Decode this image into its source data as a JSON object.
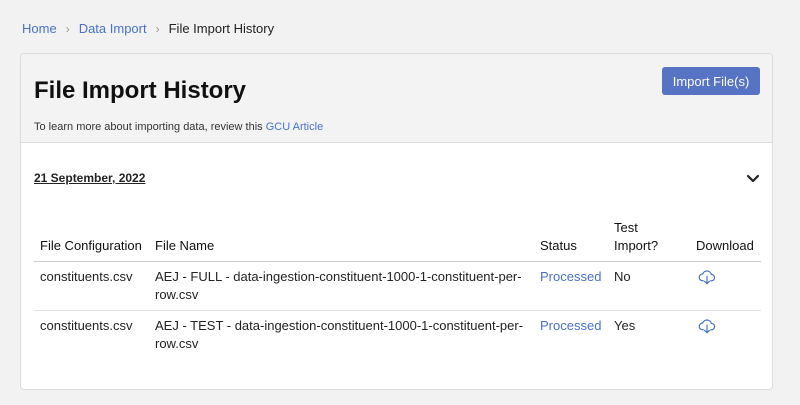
{
  "breadcrumb": {
    "items": [
      "Home",
      "Data Import"
    ],
    "current": "File Import History"
  },
  "header": {
    "title": "File Import History",
    "learn_more_prefix": "To learn more about importing data, review this",
    "learn_more_link": "GCU Article",
    "import_button": "Import File(s)"
  },
  "section": {
    "date": "21 September, 2022"
  },
  "table": {
    "headers": {
      "config": "File Configuration",
      "name": "File Name",
      "status": "Status",
      "test": "Test Import?",
      "download": "Download"
    },
    "rows": [
      {
        "config": "constituents.csv",
        "name": "AEJ - FULL - data-ingestion-constituent-1000-1-constituent-per-row.csv",
        "status": "Processed",
        "test": "No"
      },
      {
        "config": "constituents.csv",
        "name": "AEJ - TEST - data-ingestion-constituent-1000-1-constituent-per-row.csv",
        "status": "Processed",
        "test": "Yes"
      }
    ]
  },
  "colors": {
    "accent": "#5673c4",
    "link": "#4a72c8"
  },
  "icons": {
    "collapse": "chevron-down-icon",
    "download": "cloud-download-icon"
  }
}
